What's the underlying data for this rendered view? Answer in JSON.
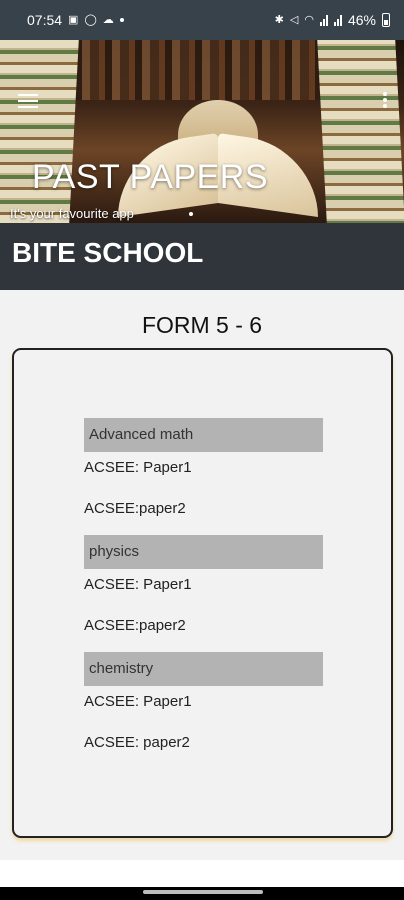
{
  "status_bar": {
    "time": "07:54",
    "battery_text": "46%",
    "left_icons": [
      "image-icon",
      "whatsapp-icon",
      "cloud-icon"
    ],
    "right_icons": [
      "bluetooth-icon",
      "mute-icon",
      "wifi-icon",
      "signal-icon",
      "signal-icon",
      "battery-icon"
    ]
  },
  "header": {
    "title": "PAST PAPERS",
    "subtitle": "It's your favourite app"
  },
  "app_bar": {
    "title": "BITE SCHOOL"
  },
  "section": {
    "title": "FORM 5 - 6"
  },
  "subjects": [
    {
      "name": "Advanced math",
      "papers": [
        "ACSEE: Paper1",
        "ACSEE:paper2"
      ]
    },
    {
      "name": "physics",
      "papers": [
        "ACSEE: Paper1",
        "ACSEE:paper2"
      ]
    },
    {
      "name": "chemistry",
      "papers": [
        "ACSEE: Paper1",
        "ACSEE: paper2"
      ]
    }
  ],
  "colors": {
    "status_bar": "#38424a",
    "app_bar": "#2f353a",
    "subject_header": "#b3b3b3",
    "background": "#f2f2f2"
  }
}
